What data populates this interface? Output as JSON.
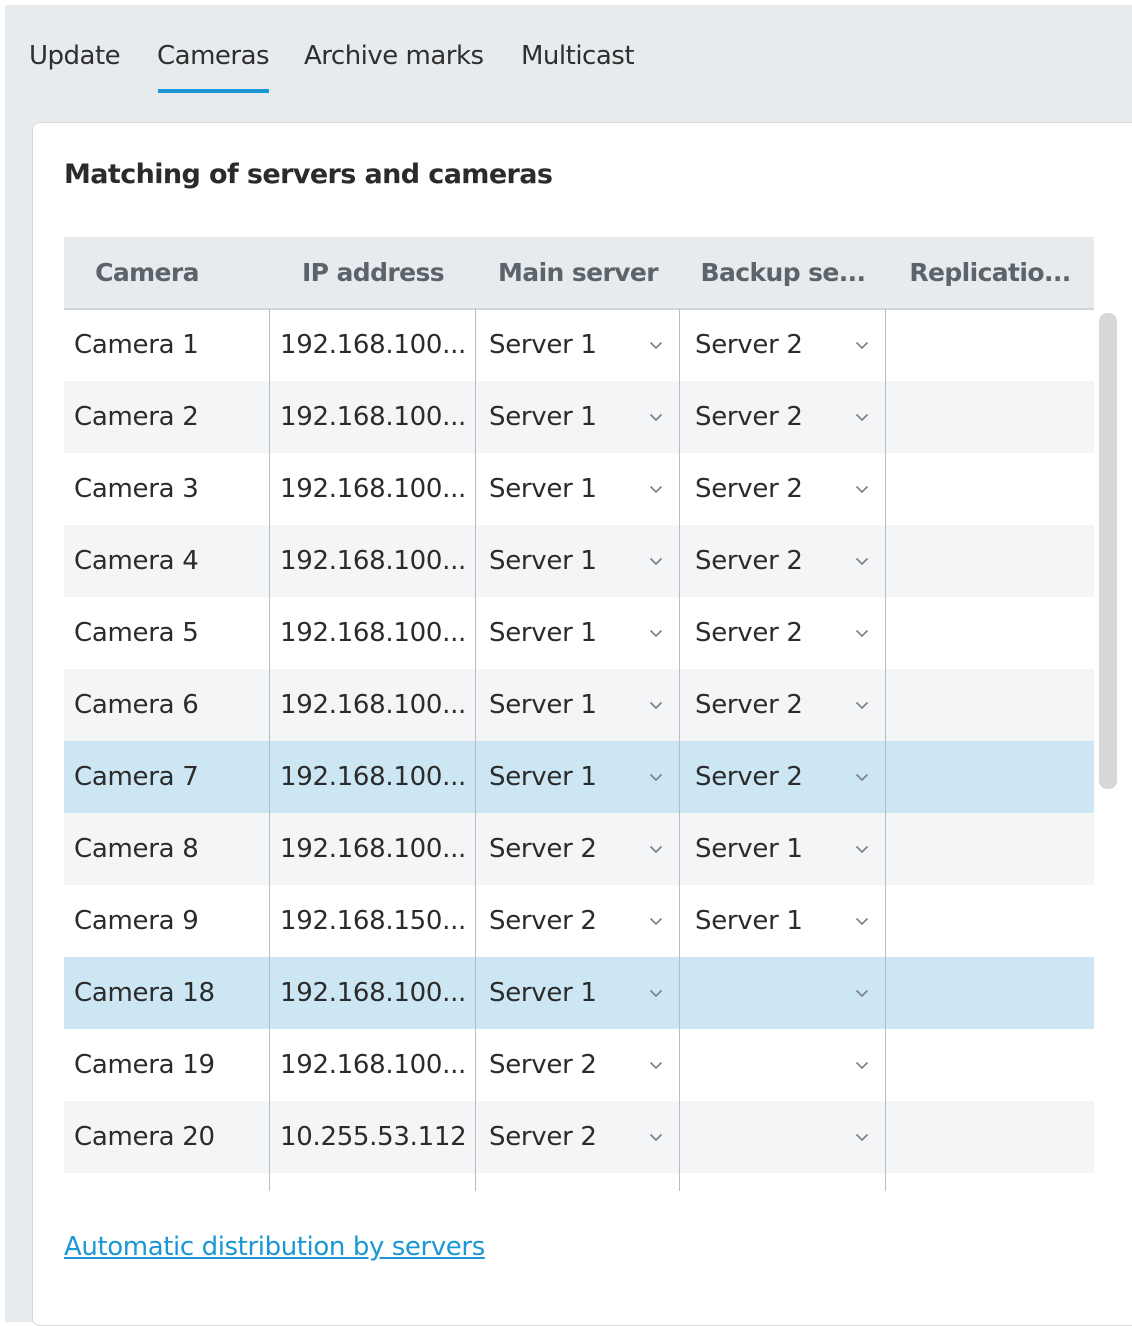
{
  "tabs": [
    "Update",
    "Cameras",
    "Archive marks",
    "Multicast"
  ],
  "active_tab": "Cameras",
  "panel": {
    "title": "Matching of servers and cameras",
    "link": "Automatic distribution by servers"
  },
  "table": {
    "columns": [
      "Camera",
      "IP address",
      "Main server",
      "Backup se...",
      "Replicatio..."
    ],
    "rows": [
      {
        "camera": "Camera 1",
        "ip": "192.168.100...",
        "main": "Server 1",
        "backup": "Server 2",
        "replication": "",
        "selected": false
      },
      {
        "camera": "Camera 2",
        "ip": "192.168.100...",
        "main": "Server 1",
        "backup": "Server 2",
        "replication": "",
        "selected": false
      },
      {
        "camera": "Camera 3",
        "ip": "192.168.100...",
        "main": "Server 1",
        "backup": "Server 2",
        "replication": "",
        "selected": false
      },
      {
        "camera": "Camera 4",
        "ip": "192.168.100...",
        "main": "Server 1",
        "backup": "Server 2",
        "replication": "",
        "selected": false
      },
      {
        "camera": "Camera 5",
        "ip": "192.168.100...",
        "main": "Server 1",
        "backup": "Server 2",
        "replication": "",
        "selected": false
      },
      {
        "camera": "Camera 6",
        "ip": "192.168.100...",
        "main": "Server 1",
        "backup": "Server 2",
        "replication": "",
        "selected": false
      },
      {
        "camera": "Camera 7",
        "ip": "192.168.100...",
        "main": "Server 1",
        "backup": "Server 2",
        "replication": "",
        "selected": true
      },
      {
        "camera": "Camera 8",
        "ip": "192.168.100...",
        "main": "Server 2",
        "backup": "Server 1",
        "replication": "",
        "selected": false
      },
      {
        "camera": "Camera 9",
        "ip": "192.168.150...",
        "main": "Server 2",
        "backup": "Server 1",
        "replication": "",
        "selected": false
      },
      {
        "camera": "Camera 18",
        "ip": "192.168.100...",
        "main": "Server 1",
        "backup": "",
        "replication": "",
        "selected": true
      },
      {
        "camera": "Camera 19",
        "ip": "192.168.100...",
        "main": "Server 2",
        "backup": "",
        "replication": "",
        "selected": false
      },
      {
        "camera": "Camera 20",
        "ip": "10.255.53.112",
        "main": "Server 2",
        "backup": "",
        "replication": "",
        "selected": false
      }
    ]
  },
  "colors": {
    "accent": "#1a97d4",
    "selected_row": "#cce7f3",
    "header_bg": "#e8ebee"
  },
  "icons": {
    "dropdown": "chevron-down-icon"
  }
}
